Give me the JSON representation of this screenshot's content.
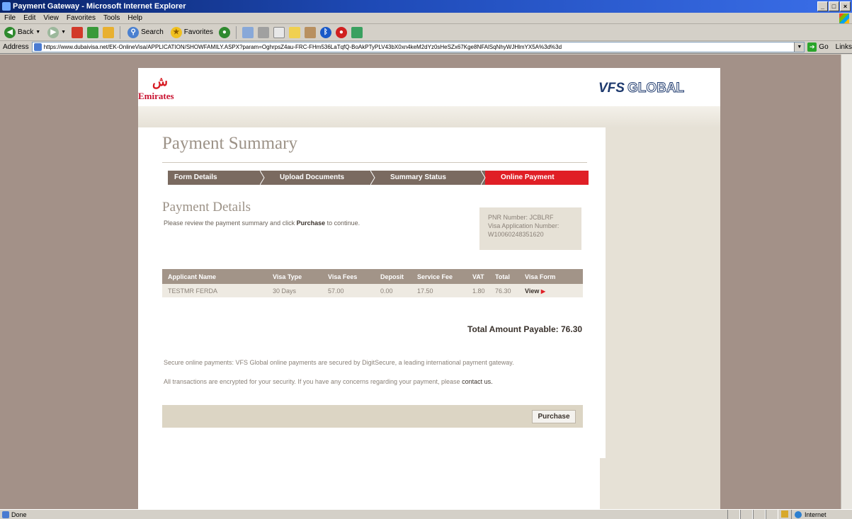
{
  "window": {
    "title": "Payment Gateway - Microsoft Internet Explorer",
    "controls": [
      "_",
      "□",
      "×"
    ]
  },
  "menu": [
    "File",
    "Edit",
    "View",
    "Favorites",
    "Tools",
    "Help"
  ],
  "toolbar": {
    "back_label": "Back",
    "search_label": "Search",
    "favorites_label": "Favorites"
  },
  "address": {
    "label": "Address",
    "url": "https://www.dubaivisa.net/EK-OnlineVisa/APPLICATION/SHOWFAMILY.ASPX?param=OghrpsZ4au-FRC-FHm536LaTqfQ-BoAkPTyPLV43bX0xn4keM2dYz0sHeSZx67Kge8NFAlSqNhyWJHlmYX5A%3d%3d",
    "go_label": "Go",
    "links_label": "Links"
  },
  "header": {
    "emirates_brand": "Emirates",
    "emirates_emblem": "ش",
    "vfs_part1": "VFS",
    "vfs_part2": "GLOBAL"
  },
  "page": {
    "title": "Payment Summary",
    "section_title": "Payment Details",
    "instructions_before": "Please review the payment summary and click ",
    "instructions_bold": "Purchase",
    "instructions_after": " to continue.",
    "pnr_line": "PNR Number: JCBLRF",
    "visa_app_label": "Visa Application Number:",
    "visa_app_number": "W10060248351620",
    "total": "Total Amount Payable: 76.30",
    "secure_text": "Secure online payments: VFS Global online payments are secured by DigitSecure, a leading international payment gateway.",
    "encrypted_text": "All transactions are encrypted for your security. If you have any concerns regarding your payment, please ",
    "contact_link": "contact us.",
    "purchase_label": "Purchase"
  },
  "steps": [
    {
      "label": "Form Details",
      "active": false
    },
    {
      "label": "Upload Documents",
      "active": false
    },
    {
      "label": "Summary Status",
      "active": false
    },
    {
      "label": "Online Payment",
      "active": true
    }
  ],
  "table": {
    "headers": [
      "Applicant Name",
      "Visa Type",
      "Visa Fees",
      "Deposit",
      "Service Fee",
      "VAT",
      "Total",
      "Visa Form"
    ],
    "rows": [
      {
        "name": "TESTMR FERDA",
        "visa_type": "30 Days",
        "visa_fees": "57.00",
        "deposit": "0.00",
        "service_fee": "17.50",
        "vat": "1.80",
        "total": "76.30",
        "visa_form": "View"
      }
    ]
  },
  "status": {
    "text": "Done",
    "zone": "Internet"
  },
  "colors": {
    "active_step": "#e01f26",
    "inactive_step": "#7a6a60",
    "background": "#a39188",
    "panel": "#e6e1d6"
  }
}
